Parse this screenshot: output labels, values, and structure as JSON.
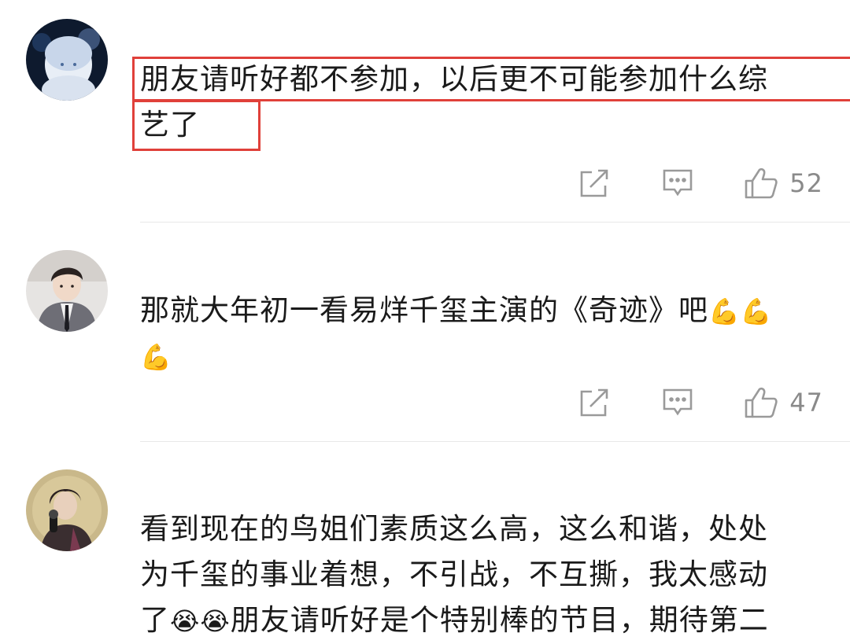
{
  "comments": [
    {
      "lines": [
        "朋友请听好都不参加，以后更不可能参加什么综",
        "艺了"
      ],
      "likes": "52",
      "avatar_icon": "anime-boy-avatar"
    },
    {
      "line1": "那就大年初一看易烊千玺主演的《奇迹》吧",
      "line1_emoji": "💪💪",
      "line2_emoji": "💪",
      "likes": "47",
      "avatar_icon": "boy-in-suit-avatar"
    },
    {
      "lines": [
        "看到现在的鸟姐们素质这么高，这么和谐，处处",
        "为千玺的事业着想，不引战，不互撕，我太感动"
      ],
      "line3_start": "了",
      "line3_emoji": "😭😭",
      "line3_end": "朋友请听好是个特别棒的节目，期待第二",
      "avatar_icon": "singer-with-microphone-avatar"
    }
  ],
  "colors": {
    "highlight": "#e0403a",
    "icon": "#9a9a9a",
    "divider": "#e8e8e8"
  }
}
